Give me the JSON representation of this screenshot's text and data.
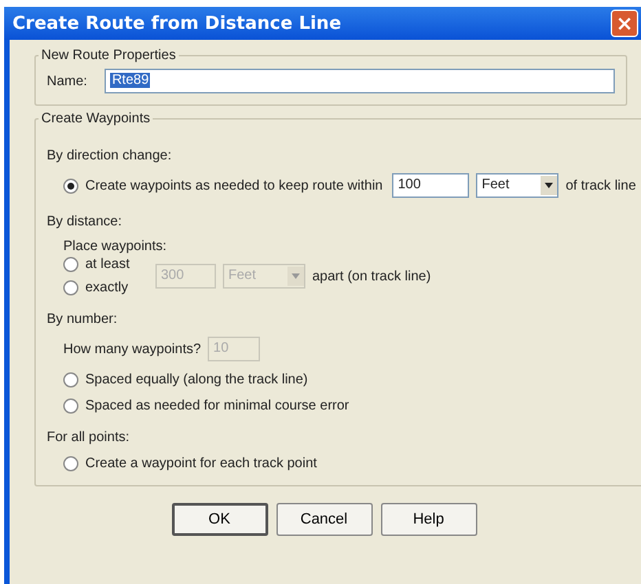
{
  "window": {
    "title": "Create Route from Distance Line",
    "close": "×"
  },
  "route_properties": {
    "title": "New Route Properties",
    "name_label": "Name:",
    "name_value": "Rte89"
  },
  "waypoints": {
    "title": "Create Waypoints",
    "direction": {
      "heading": "By direction change:",
      "radio": {
        "label": "Create waypoints as needed to keep route within",
        "selected": true
      },
      "value": "100",
      "unit": "Feet",
      "suffix": "of track line"
    },
    "distance": {
      "heading": "By distance:",
      "prompt": "Place waypoints:",
      "radios": [
        {
          "label": "at least",
          "selected": false
        },
        {
          "label": "exactly",
          "selected": false
        }
      ],
      "value": "300",
      "unit": "Feet",
      "disabled": true,
      "suffix": "apart (on track line)"
    },
    "number": {
      "heading": "By number:",
      "prompt": "How many waypoints?",
      "value": "10",
      "disabled": true,
      "radios": [
        {
          "label": "Spaced equally (along the track line)",
          "selected": false
        },
        {
          "label": "Spaced as needed for minimal course error",
          "selected": false
        }
      ]
    },
    "all_points": {
      "heading": "For all points:",
      "radio": {
        "label": "Create a waypoint for each track point",
        "selected": false
      }
    }
  },
  "buttons": [
    {
      "label": "OK",
      "default": true
    },
    {
      "label": "Cancel",
      "default": false
    },
    {
      "label": "Help",
      "default": false
    }
  ]
}
